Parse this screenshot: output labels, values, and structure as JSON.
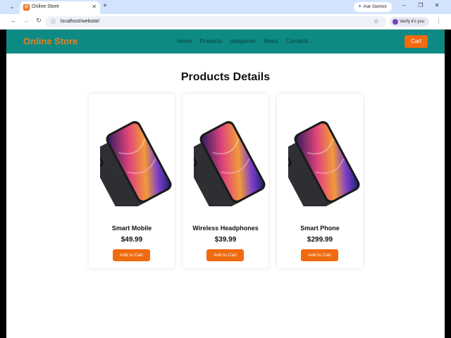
{
  "browser": {
    "tab_title": "Online Store",
    "tab_favicon": "▤",
    "url": "localhost/website/",
    "gemini_label": "Ask Gemini",
    "verify_label": "Verify it's you"
  },
  "site": {
    "logo": "Online Store",
    "nav": [
      "Home",
      "Products",
      "categories",
      "About",
      "Contacts"
    ],
    "cart_label": "Cart"
  },
  "page_title": "Products Details",
  "products": [
    {
      "name": "Smart Mobile",
      "price": "$49.99",
      "button": "Add to Cart"
    },
    {
      "name": "Wireless Headphones",
      "price": "$39.99",
      "button": "Add to Cart"
    },
    {
      "name": "Smart Phone",
      "price": "$299.99",
      "button": "Add to Cart"
    }
  ],
  "colors": {
    "header_bg": "#0e8a84",
    "accent_orange": "#f06a0f",
    "logo_orange": "#f07d1e"
  }
}
